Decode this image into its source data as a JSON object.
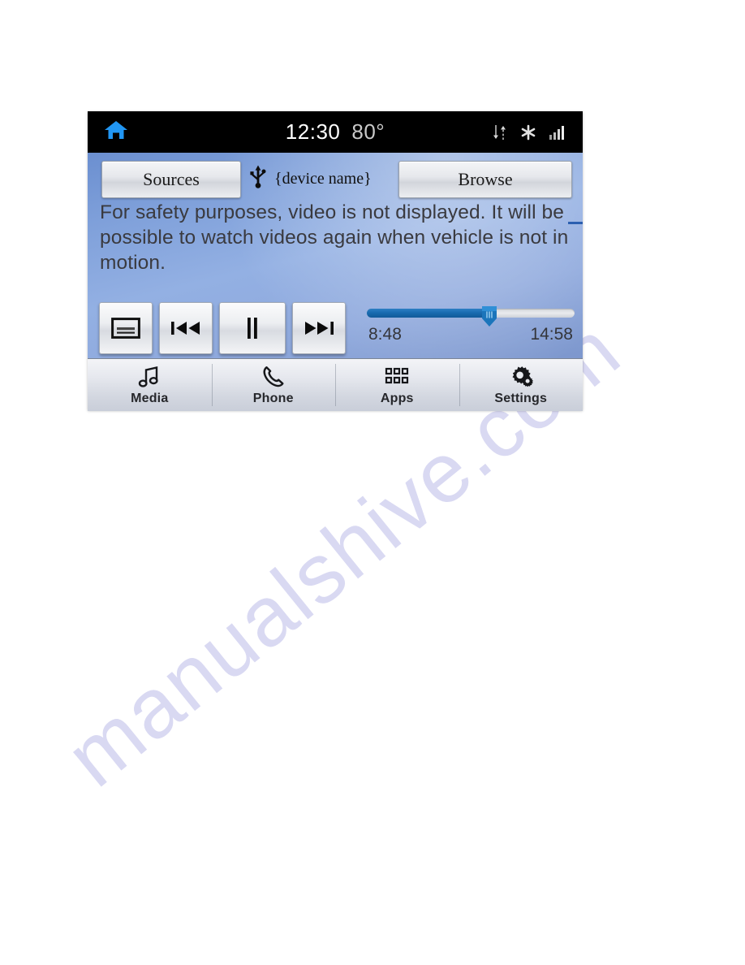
{
  "page": {
    "watermark": "manualshive.com"
  },
  "statusbar": {
    "home_icon": "home-icon",
    "clock": "12:30",
    "temperature": "80°",
    "icons": [
      {
        "name": "data-transfer-icon",
        "label": "data transfer"
      },
      {
        "name": "snowflake-icon",
        "label": "climate"
      },
      {
        "name": "signal-bars-icon",
        "label": "signal strength"
      }
    ]
  },
  "toolbar": {
    "sources_label": "Sources",
    "browse_label": "Browse",
    "usb_icon": "usb-icon",
    "device_name": "{device name}"
  },
  "message": {
    "text": "For safety purposes, video is not displayed. It will be possible to watch videos again when vehicle is not in motion."
  },
  "player": {
    "controls": [
      {
        "name": "subtitles-button",
        "icon": "subtitles-icon",
        "label": "Subtitles"
      },
      {
        "name": "previous-track-button",
        "icon": "previous-track-icon",
        "label": "Previous"
      },
      {
        "name": "pause-button",
        "icon": "pause-icon",
        "label": "Pause"
      },
      {
        "name": "next-track-button",
        "icon": "next-track-icon",
        "label": "Next"
      }
    ],
    "elapsed_time": "8:48",
    "total_time": "14:58",
    "progress_percent": 59,
    "accent_color": "#1769ae"
  },
  "navbar": {
    "items": [
      {
        "label": "Media",
        "icon": "music-note-icon"
      },
      {
        "label": "Phone",
        "icon": "phone-handset-icon"
      },
      {
        "label": "Apps",
        "icon": "apps-grid-icon"
      },
      {
        "label": "Settings",
        "icon": "gears-icon"
      }
    ]
  }
}
